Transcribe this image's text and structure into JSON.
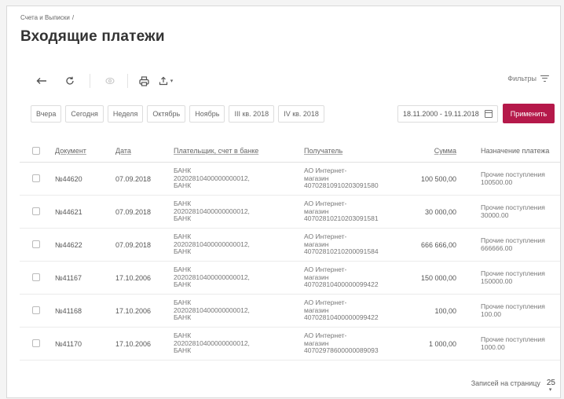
{
  "breadcrumb": {
    "parent": "Счета и Выписки",
    "separator": "/"
  },
  "page_title": "Входящие платежи",
  "toolbar": {
    "icons": {
      "back": "back-arrow-icon",
      "refresh": "refresh-icon",
      "view": "eye-icon",
      "print": "print-icon",
      "export": "export-icon"
    },
    "filters_label": "Фильтры"
  },
  "periods": [
    "Вчера",
    "Сегодня",
    "Неделя",
    "Октябрь",
    "Ноябрь",
    "III кв. 2018",
    "IV кв. 2018"
  ],
  "date_range": "18.11.2000 - 19.11.2018",
  "apply_label": "Применить",
  "table": {
    "headers": {
      "document": "Документ",
      "date": "Дата",
      "payer": "Плательщик, счет в банке",
      "recipient": "Получатель",
      "amount": "Сумма",
      "purpose": "Назначение платежа"
    },
    "rows": [
      {
        "doc": "№44620",
        "date": "07.09.2018",
        "payer_bank": "БАНК",
        "payer_account": "20202810400000000012,",
        "payer_bank2": "БАНК",
        "rec_1": "АО Интернет-",
        "rec_2": "магазин",
        "rec_account": "40702810910203091580",
        "amount": "100 500,00",
        "purpose_1": "Прочие поступления",
        "purpose_2": "100500.00"
      },
      {
        "doc": "№44621",
        "date": "07.09.2018",
        "payer_bank": "БАНК",
        "payer_account": "20202810400000000012,",
        "payer_bank2": "БАНК",
        "rec_1": "АО Интернет-",
        "rec_2": "магазин",
        "rec_account": "40702810210203091581",
        "amount": "30 000,00",
        "purpose_1": "Прочие поступления",
        "purpose_2": "30000.00"
      },
      {
        "doc": "№44622",
        "date": "07.09.2018",
        "payer_bank": "БАНК",
        "payer_account": "20202810400000000012,",
        "payer_bank2": "БАНК",
        "rec_1": "АО Интернет-",
        "rec_2": "магазин",
        "rec_account": "40702810210200091584",
        "amount": "666 666,00",
        "purpose_1": "Прочие поступления",
        "purpose_2": "666666.00"
      },
      {
        "doc": "№41167",
        "date": "17.10.2006",
        "payer_bank": "БАНК",
        "payer_account": "20202810400000000012,",
        "payer_bank2": "БАНК",
        "rec_1": "АО Интернет-",
        "rec_2": "магазин",
        "rec_account": "40702810400000099422",
        "amount": "150 000,00",
        "purpose_1": "Прочие поступления",
        "purpose_2": "150000.00"
      },
      {
        "doc": "№41168",
        "date": "17.10.2006",
        "payer_bank": "БАНК",
        "payer_account": "20202810400000000012,",
        "payer_bank2": "БАНК",
        "rec_1": "АО Интернет-",
        "rec_2": "магазин",
        "rec_account": "40702810400000099422",
        "amount": "100,00",
        "purpose_1": "Прочие поступления",
        "purpose_2": "100.00"
      },
      {
        "doc": "№41170",
        "date": "17.10.2006",
        "payer_bank": "БАНК",
        "payer_account": "20202810400000000012,",
        "payer_bank2": "БАНК",
        "rec_1": "АО Интернет-",
        "rec_2": "магазин",
        "rec_account": "40702978600000089093",
        "amount": "1 000,00",
        "purpose_1": "Прочие поступления",
        "purpose_2": "1000.00"
      }
    ]
  },
  "footer": {
    "per_page_label": "Записей на страницу",
    "per_page_value": "25"
  },
  "colors": {
    "accent": "#b5194a"
  }
}
